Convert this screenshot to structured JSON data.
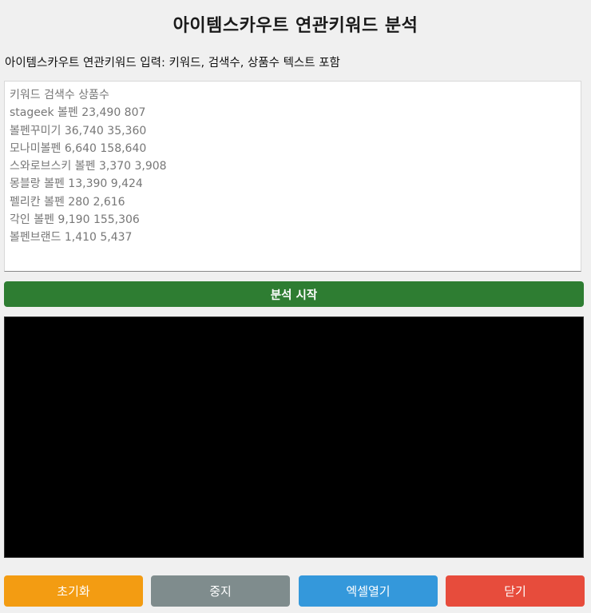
{
  "header": {
    "title": "아이템스카우트 연관키워드 분석"
  },
  "input": {
    "label": "아이템스카우트 연관키워드 입력: 키워드, 검색수, 상품수 텍스트 포함",
    "placeholder": "키워드 검색수 상품수\nstageek 볼펜 23,490 807\n볼펜꾸미기 36,740 35,360\n모나미볼펜 6,640 158,640\n스와로브스키 볼펜 3,370 3,908\n몽블랑 볼펜 13,390 9,424\n펠리칸 볼펜 280 2,616\n각인 볼펜 9,190 155,306\n볼펜브랜드 1,410 5,437",
    "value": ""
  },
  "actions": {
    "start_label": "분석 시작"
  },
  "footer": {
    "reset_label": "초기화",
    "stop_label": "중지",
    "excel_label": "엑셀열기",
    "close_label": "닫기"
  },
  "colors": {
    "start": "#2e7d32",
    "reset": "#f39c12",
    "stop": "#7f8c8d",
    "excel": "#3498db",
    "close": "#e74c3c",
    "output_bg": "#000000"
  }
}
